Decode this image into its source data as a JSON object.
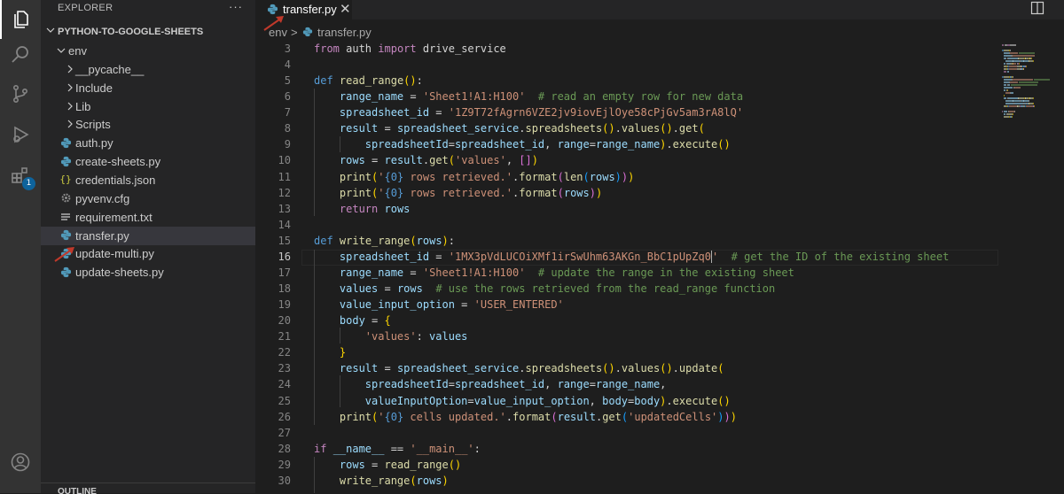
{
  "activity_bar": {
    "items": [
      {
        "name": "explorer",
        "icon": "files-icon"
      },
      {
        "name": "search",
        "icon": "search-icon"
      },
      {
        "name": "source-control",
        "icon": "source-control-icon"
      },
      {
        "name": "run-debug",
        "icon": "debug-icon"
      },
      {
        "name": "extensions",
        "icon": "extensions-icon",
        "badge": "1"
      }
    ],
    "account_icon": "account-icon"
  },
  "sidebar": {
    "header": "EXPLORER",
    "more": "···",
    "section": "PYTHON-TO-GOOGLE-SHEETS",
    "outline": "OUTLINE",
    "tree": [
      {
        "label": "env",
        "type": "folder-open",
        "depth": 0
      },
      {
        "label": "__pycache__",
        "type": "folder",
        "depth": 1
      },
      {
        "label": "Include",
        "type": "folder",
        "depth": 1
      },
      {
        "label": "Lib",
        "type": "folder",
        "depth": 1
      },
      {
        "label": "Scripts",
        "type": "folder",
        "depth": 1
      },
      {
        "label": "auth.py",
        "type": "python",
        "depth": 1
      },
      {
        "label": "create-sheets.py",
        "type": "python",
        "depth": 1
      },
      {
        "label": "credentials.json",
        "type": "json",
        "depth": 1
      },
      {
        "label": "pyvenv.cfg",
        "type": "config",
        "depth": 1
      },
      {
        "label": "requirement.txt",
        "type": "text",
        "depth": 1
      },
      {
        "label": "transfer.py",
        "type": "python",
        "depth": 1,
        "selected": true
      },
      {
        "label": "update-multi.py",
        "type": "python",
        "depth": 1
      },
      {
        "label": "update-sheets.py",
        "type": "python",
        "depth": 1
      }
    ]
  },
  "editor": {
    "tab": {
      "label": "transfer.py",
      "close": "✕"
    },
    "breadcrumb": [
      "env",
      "transfer.py"
    ],
    "breadcrumb_sep": ">",
    "current_line": 16,
    "line_numbers": [
      "3",
      "4",
      "5",
      "6",
      "7",
      "8",
      "9",
      "10",
      "11",
      "12",
      "13",
      "14",
      "15",
      "16",
      "17",
      "18",
      "19",
      "20",
      "21",
      "22",
      "23",
      "24",
      "25",
      "26",
      "27",
      "28",
      "29",
      "30"
    ],
    "code_lines": [
      [
        {
          "c": "kc",
          "t": "from"
        },
        {
          "c": "t",
          "t": " auth "
        },
        {
          "c": "kc",
          "t": "import"
        },
        {
          "c": "t",
          "t": " drive_service"
        }
      ],
      [],
      [
        {
          "c": "k",
          "t": "def"
        },
        {
          "c": "t",
          "t": " "
        },
        {
          "c": "f",
          "t": "read_range"
        },
        {
          "c": "b1",
          "t": "()"
        },
        {
          "c": "t",
          "t": ":"
        }
      ],
      [
        {
          "c": "t",
          "t": "    "
        },
        {
          "c": "v",
          "t": "range_name"
        },
        {
          "c": "t",
          "t": " = "
        },
        {
          "c": "s",
          "t": "'Sheet1!A1:H100'"
        },
        {
          "c": "t",
          "t": "  "
        },
        {
          "c": "c",
          "t": "# read an empty row for new data"
        }
      ],
      [
        {
          "c": "t",
          "t": "    "
        },
        {
          "c": "v",
          "t": "spreadsheet_id"
        },
        {
          "c": "t",
          "t": " = "
        },
        {
          "c": "s",
          "t": "'1Z9T72fAgrn6VZE2jv9iovEjlOye58cPjGv5am3rA8lQ'"
        }
      ],
      [
        {
          "c": "t",
          "t": "    "
        },
        {
          "c": "v",
          "t": "result"
        },
        {
          "c": "t",
          "t": " = "
        },
        {
          "c": "v",
          "t": "spreadsheet_service"
        },
        {
          "c": "t",
          "t": "."
        },
        {
          "c": "f",
          "t": "spreadsheets"
        },
        {
          "c": "b1",
          "t": "()"
        },
        {
          "c": "t",
          "t": "."
        },
        {
          "c": "f",
          "t": "values"
        },
        {
          "c": "b1",
          "t": "()"
        },
        {
          "c": "t",
          "t": "."
        },
        {
          "c": "f",
          "t": "get"
        },
        {
          "c": "b1",
          "t": "("
        }
      ],
      [
        {
          "c": "t",
          "t": "        "
        },
        {
          "c": "v",
          "t": "spreadsheetId"
        },
        {
          "c": "t",
          "t": "="
        },
        {
          "c": "v",
          "t": "spreadsheet_id"
        },
        {
          "c": "t",
          "t": ", "
        },
        {
          "c": "v",
          "t": "range"
        },
        {
          "c": "t",
          "t": "="
        },
        {
          "c": "v",
          "t": "range_name"
        },
        {
          "c": "b1",
          "t": ")"
        },
        {
          "c": "t",
          "t": "."
        },
        {
          "c": "f",
          "t": "execute"
        },
        {
          "c": "b1",
          "t": "()"
        }
      ],
      [
        {
          "c": "t",
          "t": "    "
        },
        {
          "c": "v",
          "t": "rows"
        },
        {
          "c": "t",
          "t": " = "
        },
        {
          "c": "v",
          "t": "result"
        },
        {
          "c": "t",
          "t": "."
        },
        {
          "c": "f",
          "t": "get"
        },
        {
          "c": "b1",
          "t": "("
        },
        {
          "c": "s",
          "t": "'values'"
        },
        {
          "c": "t",
          "t": ", "
        },
        {
          "c": "b2",
          "t": "[]"
        },
        {
          "c": "b1",
          "t": ")"
        }
      ],
      [
        {
          "c": "t",
          "t": "    "
        },
        {
          "c": "f",
          "t": "print"
        },
        {
          "c": "b1",
          "t": "("
        },
        {
          "c": "s",
          "t": "'"
        },
        {
          "c": "k",
          "t": "{0}"
        },
        {
          "c": "s",
          "t": " rows retrieved.'"
        },
        {
          "c": "t",
          "t": "."
        },
        {
          "c": "f",
          "t": "format"
        },
        {
          "c": "b2",
          "t": "("
        },
        {
          "c": "f",
          "t": "len"
        },
        {
          "c": "b3",
          "t": "("
        },
        {
          "c": "v",
          "t": "rows"
        },
        {
          "c": "b3",
          "t": ")"
        },
        {
          "c": "b2",
          "t": ")"
        },
        {
          "c": "b1",
          "t": ")"
        }
      ],
      [
        {
          "c": "t",
          "t": "    "
        },
        {
          "c": "f",
          "t": "print"
        },
        {
          "c": "b1",
          "t": "("
        },
        {
          "c": "s",
          "t": "'"
        },
        {
          "c": "k",
          "t": "{0}"
        },
        {
          "c": "s",
          "t": " rows retrieved.'"
        },
        {
          "c": "t",
          "t": "."
        },
        {
          "c": "f",
          "t": "format"
        },
        {
          "c": "b2",
          "t": "("
        },
        {
          "c": "v",
          "t": "rows"
        },
        {
          "c": "b2",
          "t": ")"
        },
        {
          "c": "b1",
          "t": ")"
        }
      ],
      [
        {
          "c": "t",
          "t": "    "
        },
        {
          "c": "kc",
          "t": "return"
        },
        {
          "c": "t",
          "t": " "
        },
        {
          "c": "v",
          "t": "rows"
        }
      ],
      [],
      [
        {
          "c": "k",
          "t": "def"
        },
        {
          "c": "t",
          "t": " "
        },
        {
          "c": "f",
          "t": "write_range"
        },
        {
          "c": "b1",
          "t": "("
        },
        {
          "c": "v",
          "t": "rows"
        },
        {
          "c": "b1",
          "t": ")"
        },
        {
          "c": "t",
          "t": ":"
        }
      ],
      [
        {
          "c": "t",
          "t": "    "
        },
        {
          "c": "v",
          "t": "spreadsheet_id"
        },
        {
          "c": "t",
          "t": " = "
        },
        {
          "c": "s",
          "t": "'1MX3pVdLUCOiXMf1irSwUhm63AKGn_BbC1pUpZq0"
        },
        {
          "caret": true
        },
        {
          "c": "s",
          "t": "'"
        },
        {
          "c": "t",
          "t": "  "
        },
        {
          "c": "c",
          "t": "# get the ID of the existing sheet"
        }
      ],
      [
        {
          "c": "t",
          "t": "    "
        },
        {
          "c": "v",
          "t": "range_name"
        },
        {
          "c": "t",
          "t": " = "
        },
        {
          "c": "s",
          "t": "'Sheet1!A1:H100'"
        },
        {
          "c": "t",
          "t": "  "
        },
        {
          "c": "c",
          "t": "# update the range in the existing sheet"
        }
      ],
      [
        {
          "c": "t",
          "t": "    "
        },
        {
          "c": "v",
          "t": "values"
        },
        {
          "c": "t",
          "t": " = "
        },
        {
          "c": "v",
          "t": "rows"
        },
        {
          "c": "t",
          "t": "  "
        },
        {
          "c": "c",
          "t": "# use the rows retrieved from the read_range function"
        }
      ],
      [
        {
          "c": "t",
          "t": "    "
        },
        {
          "c": "v",
          "t": "value_input_option"
        },
        {
          "c": "t",
          "t": " = "
        },
        {
          "c": "s",
          "t": "'USER_ENTERED'"
        }
      ],
      [
        {
          "c": "t",
          "t": "    "
        },
        {
          "c": "v",
          "t": "body"
        },
        {
          "c": "t",
          "t": " = "
        },
        {
          "c": "b1",
          "t": "{"
        }
      ],
      [
        {
          "c": "t",
          "t": "        "
        },
        {
          "c": "s",
          "t": "'values'"
        },
        {
          "c": "t",
          "t": ": "
        },
        {
          "c": "v",
          "t": "values"
        }
      ],
      [
        {
          "c": "t",
          "t": "    "
        },
        {
          "c": "b1",
          "t": "}"
        }
      ],
      [
        {
          "c": "t",
          "t": "    "
        },
        {
          "c": "v",
          "t": "result"
        },
        {
          "c": "t",
          "t": " = "
        },
        {
          "c": "v",
          "t": "spreadsheet_service"
        },
        {
          "c": "t",
          "t": "."
        },
        {
          "c": "f",
          "t": "spreadsheets"
        },
        {
          "c": "b1",
          "t": "()"
        },
        {
          "c": "t",
          "t": "."
        },
        {
          "c": "f",
          "t": "values"
        },
        {
          "c": "b1",
          "t": "()"
        },
        {
          "c": "t",
          "t": "."
        },
        {
          "c": "f",
          "t": "update"
        },
        {
          "c": "b1",
          "t": "("
        }
      ],
      [
        {
          "c": "t",
          "t": "        "
        },
        {
          "c": "v",
          "t": "spreadsheetId"
        },
        {
          "c": "t",
          "t": "="
        },
        {
          "c": "v",
          "t": "spreadsheet_id"
        },
        {
          "c": "t",
          "t": ", "
        },
        {
          "c": "v",
          "t": "range"
        },
        {
          "c": "t",
          "t": "="
        },
        {
          "c": "v",
          "t": "range_name"
        },
        {
          "c": "t",
          "t": ","
        }
      ],
      [
        {
          "c": "t",
          "t": "        "
        },
        {
          "c": "v",
          "t": "valueInputOption"
        },
        {
          "c": "t",
          "t": "="
        },
        {
          "c": "v",
          "t": "value_input_option"
        },
        {
          "c": "t",
          "t": ", "
        },
        {
          "c": "v",
          "t": "body"
        },
        {
          "c": "t",
          "t": "="
        },
        {
          "c": "v",
          "t": "body"
        },
        {
          "c": "b1",
          "t": ")"
        },
        {
          "c": "t",
          "t": "."
        },
        {
          "c": "f",
          "t": "execute"
        },
        {
          "c": "b1",
          "t": "()"
        }
      ],
      [
        {
          "c": "t",
          "t": "    "
        },
        {
          "c": "f",
          "t": "print"
        },
        {
          "c": "b1",
          "t": "("
        },
        {
          "c": "s",
          "t": "'"
        },
        {
          "c": "k",
          "t": "{0}"
        },
        {
          "c": "s",
          "t": " cells updated.'"
        },
        {
          "c": "t",
          "t": "."
        },
        {
          "c": "f",
          "t": "format"
        },
        {
          "c": "b2",
          "t": "("
        },
        {
          "c": "v",
          "t": "result"
        },
        {
          "c": "t",
          "t": "."
        },
        {
          "c": "f",
          "t": "get"
        },
        {
          "c": "b3",
          "t": "("
        },
        {
          "c": "s",
          "t": "'updatedCells'"
        },
        {
          "c": "b3",
          "t": ")"
        },
        {
          "c": "b2",
          "t": ")"
        },
        {
          "c": "b1",
          "t": ")"
        }
      ],
      [],
      [
        {
          "c": "kc",
          "t": "if"
        },
        {
          "c": "t",
          "t": " "
        },
        {
          "c": "v",
          "t": "__name__"
        },
        {
          "c": "t",
          "t": " == "
        },
        {
          "c": "s",
          "t": "'__main__'"
        },
        {
          "c": "t",
          "t": ":"
        }
      ],
      [
        {
          "c": "t",
          "t": "    "
        },
        {
          "c": "v",
          "t": "rows"
        },
        {
          "c": "t",
          "t": " = "
        },
        {
          "c": "f",
          "t": "read_range"
        },
        {
          "c": "b1",
          "t": "()"
        }
      ],
      [
        {
          "c": "t",
          "t": "    "
        },
        {
          "c": "f",
          "t": "write_range"
        },
        {
          "c": "b1",
          "t": "("
        },
        {
          "c": "v",
          "t": "rows"
        },
        {
          "c": "b1",
          "t": ")"
        }
      ]
    ]
  },
  "colors": {
    "activity_bar": "#333333",
    "sidebar": "#252526",
    "editor": "#1e1e1e",
    "annotation_arrow": "#c0392b",
    "python_icon": "#519aba",
    "json_icon": "#cbcb41"
  }
}
